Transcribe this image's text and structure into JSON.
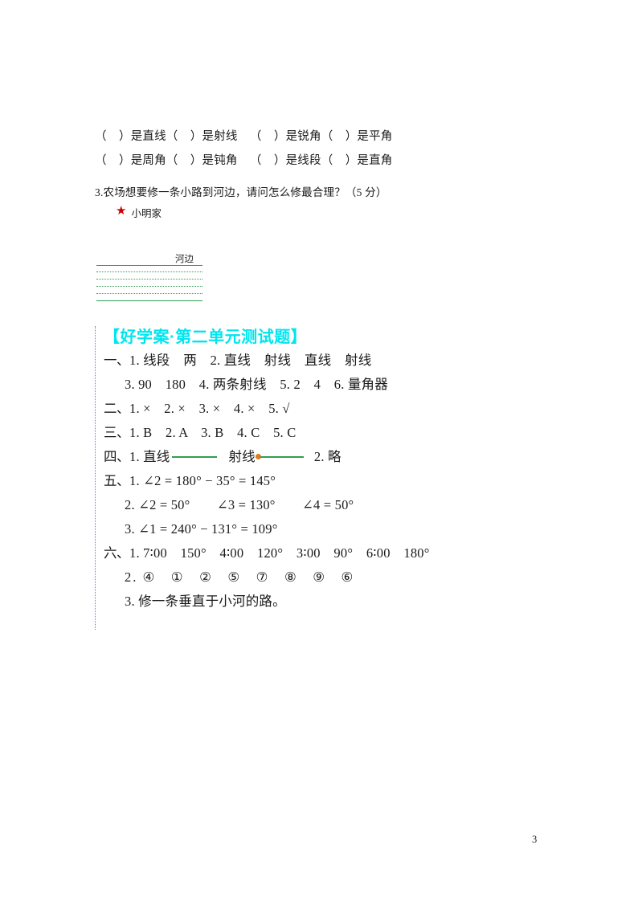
{
  "document": {
    "page_number": "3",
    "colors": {
      "heading": "#00e5ee",
      "river": "#2e9e52",
      "star": "#cc0000",
      "ray_point": "#e07b1a",
      "margin_rule": "#6b7ad6"
    }
  },
  "questions": {
    "fill_rows": [
      "（    ）是直线（    ）是射线    （    ）是锐角（    ）是平角",
      "（    ）是周角（    ）是钝角    （    ）是线段（    ）是直角"
    ],
    "q3_text": "3.农场想要修一条小路到河边，请问怎么修最合理？（5 分）",
    "house_label": "小明家",
    "star_icon": "★",
    "river_label": "河边"
  },
  "answers": {
    "title": "【好学案·第二单元测试题】",
    "sections": [
      {
        "label": "一、",
        "lines": [
          "1. 线段　两　2. 直线　射线　直线　射线",
          "3. 90　180　4. 两条射线　5. 2　4　6. 量角器"
        ]
      },
      {
        "label": "二、",
        "lines": [
          "1. ×　2. ×　3. ×　4. ×　5. √"
        ]
      },
      {
        "label": "三、",
        "lines": [
          "1. B　2. A　3. B　4. C　5. C"
        ]
      },
      {
        "label": "四、",
        "prefix": "1. 直线",
        "middle": "射线",
        "suffix": "2. 略"
      },
      {
        "label": "五、",
        "lines": [
          "1. ∠2 = 180° − 35° = 145°",
          "2. ∠2 = 50°　　∠3 = 130°　　∠4 = 50°",
          "3. ∠1 = 240° − 131° = 109°"
        ]
      },
      {
        "label": "六、",
        "lines": [
          "1. 7∶00　150°　4∶00　120°　3∶00　90°　6∶00　180°",
          "2. ④　①　②　⑤　⑦　⑧　⑨　⑥",
          "3. 修一条垂直于小河的路。"
        ]
      }
    ]
  }
}
